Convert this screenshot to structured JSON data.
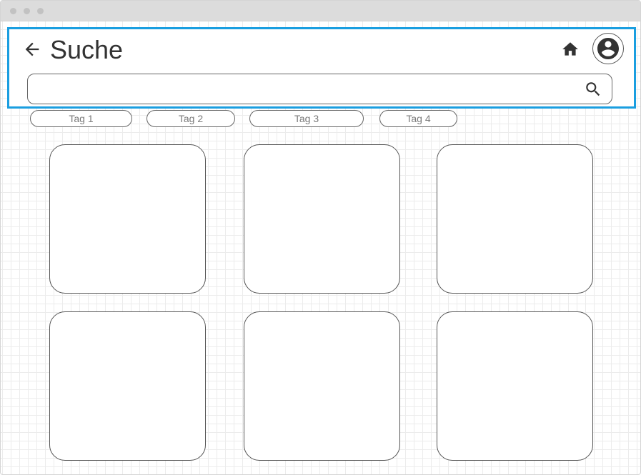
{
  "header": {
    "title": "Suche",
    "back_icon": "arrow-left-icon",
    "home_icon": "home-icon",
    "account_icon": "account-circle-icon",
    "accent_color": "#1a9ee0"
  },
  "search": {
    "value": "",
    "placeholder": "",
    "icon": "search-icon"
  },
  "tags": [
    {
      "label": "Tag 1"
    },
    {
      "label": "Tag 2"
    },
    {
      "label": "Tag 3"
    },
    {
      "label": "Tag 4"
    }
  ],
  "results": {
    "count": 6
  }
}
